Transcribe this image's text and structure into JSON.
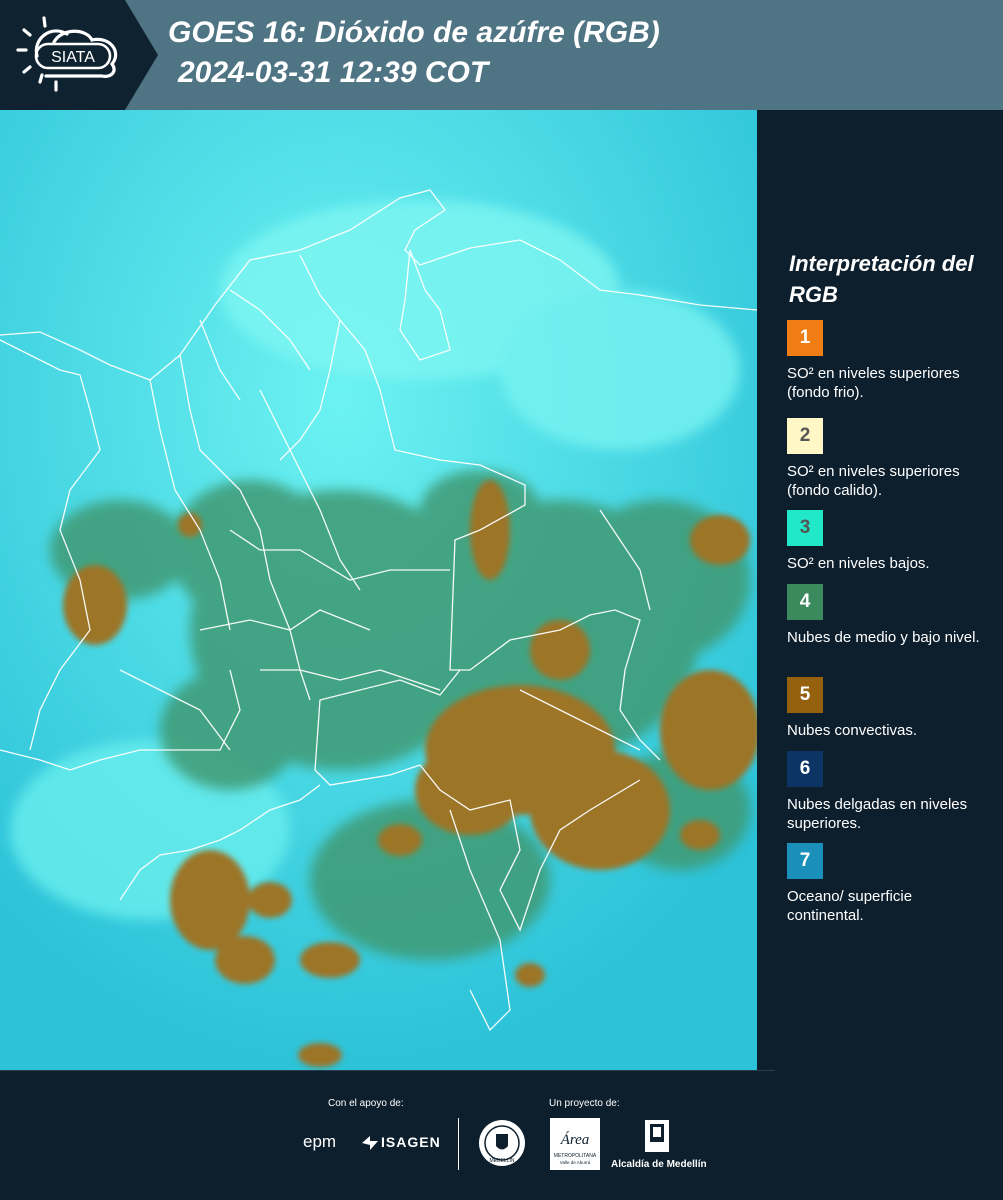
{
  "header": {
    "title_line1": "GOES 16: Dióxido de azúfre (RGB)",
    "title_line2": "2024-03-31 12:39 COT",
    "logo_text": "SIATA",
    "bar_color": "#4f7484",
    "background_color": "#0d1f2d"
  },
  "map": {
    "icon": "satellite-imagery",
    "ocean_color": "#2fc8dc",
    "low_so2_color": "#52e8ee",
    "cloud_mid_low_color": "#3d8f6a",
    "cloud_convective_color": "#9a7328",
    "border_color": "#ffffff"
  },
  "legend": {
    "title": "Interpretación del RGB",
    "items": [
      {
        "number": "1",
        "label": "SO² en niveles superiores (fondo frio).",
        "color": "#f07c14",
        "text_color": "#ffffff"
      },
      {
        "number": "2",
        "label": "SO² en niveles superiores (fondo calido).",
        "color": "#fff7c5",
        "text_color": "#555555"
      },
      {
        "number": "3",
        "label": "SO² en niveles bajos.",
        "color": "#20e8c8",
        "text_color": "#555555"
      },
      {
        "number": "4",
        "label": "Nubes de medio y bajo nivel.",
        "color": "#3b8a5e",
        "text_color": "#ffffff"
      },
      {
        "number": "5",
        "label": "Nubes convectivas.",
        "color": "#96610f",
        "text_color": "#ffffff"
      },
      {
        "number": "6",
        "label": "Nubes delgadas en niveles superiores.",
        "color": "#0c3566",
        "text_color": "#ffffff"
      },
      {
        "number": "7",
        "label": "Oceano/ superficie continental.",
        "color": "#1a8fba",
        "text_color": "#ffffff"
      }
    ]
  },
  "footer": {
    "support_caption": "Con el apoyo de:",
    "project_caption": "Un proyecto de:",
    "epm_text": "epm",
    "isagen_text": "ISAGEN",
    "area_text": "Área",
    "area_sub": "METROPOLITANA",
    "area_sub2": "Valle de Aburrá",
    "alcaldia_text": "Alcaldía de Medellín",
    "seal_text": "MEDELLÍN"
  }
}
